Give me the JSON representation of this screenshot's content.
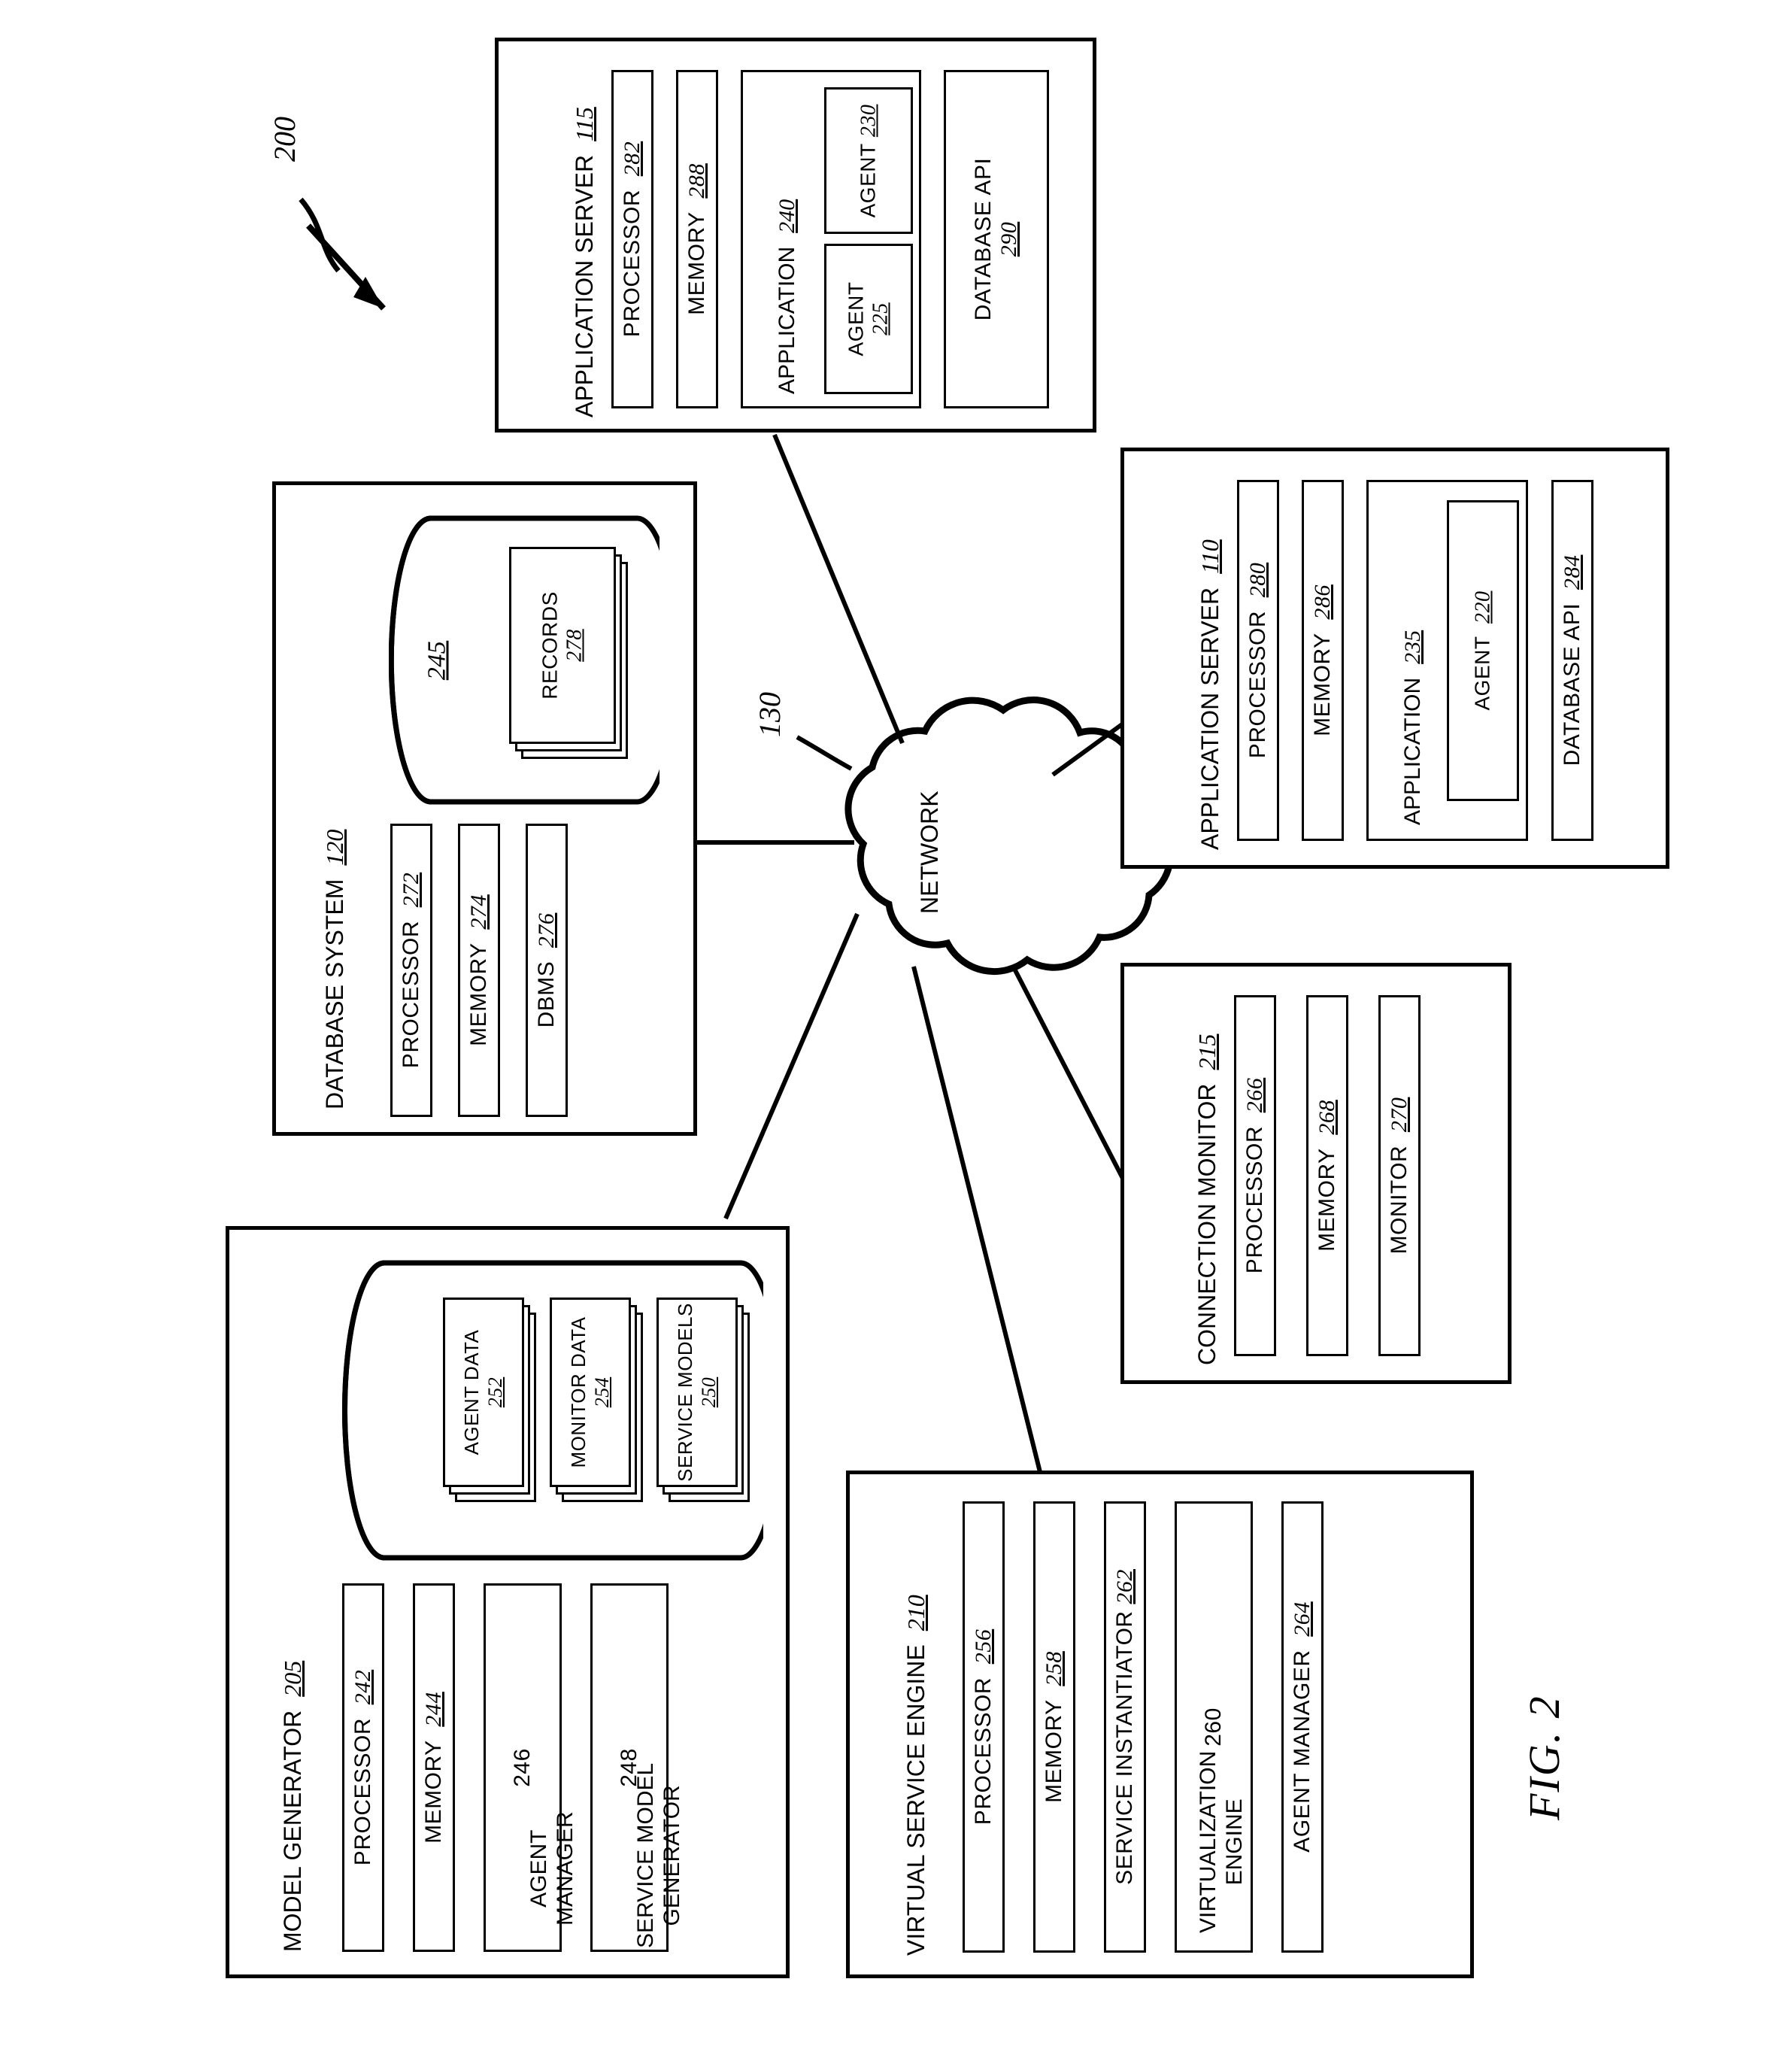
{
  "figure": {
    "caption": "FIG. 2",
    "system_ref": "200",
    "network_ref": "130",
    "network_label": "NETWORK"
  },
  "nodes": {
    "app_server_115": {
      "title": "APPLICATION SERVER",
      "ref": "115",
      "children": [
        {
          "label": "PROCESSOR",
          "ref": "282"
        },
        {
          "label": "MEMORY",
          "ref": "288"
        },
        {
          "label": "APPLICATION",
          "ref": "240"
        },
        {
          "label": "DATABASE API",
          "ref": "290"
        }
      ],
      "agents": [
        {
          "label": "AGENT",
          "ref": "225"
        },
        {
          "label": "AGENT",
          "ref": "230"
        }
      ]
    },
    "app_server_110": {
      "title": "APPLICATION SERVER",
      "ref": "110",
      "children": [
        {
          "label": "PROCESSOR",
          "ref": "280"
        },
        {
          "label": "MEMORY",
          "ref": "286"
        },
        {
          "label": "APPLICATION",
          "ref": "235"
        },
        {
          "label": "DATABASE API",
          "ref": "284"
        }
      ],
      "agents": [
        {
          "label": "AGENT",
          "ref": "220"
        }
      ]
    },
    "database_system_120": {
      "title": "DATABASE SYSTEM",
      "ref": "120",
      "store_ref": "245",
      "records": {
        "label": "RECORDS",
        "ref": "278"
      },
      "children": [
        {
          "label": "PROCESSOR",
          "ref": "272"
        },
        {
          "label": "MEMORY",
          "ref": "274"
        },
        {
          "label": "DBMS",
          "ref": "276"
        }
      ]
    },
    "connection_monitor_215": {
      "title": "CONNECTION MONITOR",
      "ref": "215",
      "children": [
        {
          "label": "PROCESSOR",
          "ref": "266"
        },
        {
          "label": "MEMORY",
          "ref": "268"
        },
        {
          "label": "MONITOR",
          "ref": "270"
        }
      ]
    },
    "model_generator_205": {
      "title": "MODEL GENERATOR",
      "ref": "205",
      "children": [
        {
          "label": "PROCESSOR",
          "ref": "242"
        },
        {
          "label": "MEMORY",
          "ref": "244"
        },
        {
          "label": "AGENT\nMANAGER",
          "ref": "246"
        },
        {
          "label": "SERVICE MODEL\nGENERATOR",
          "ref": "248"
        }
      ],
      "store_items": [
        {
          "label": "AGENT\nDATA",
          "ref": "252"
        },
        {
          "label": "MONITOR\nDATA",
          "ref": "254"
        },
        {
          "label": "SERVICE\nMODELS",
          "ref": "250"
        }
      ]
    },
    "virtual_service_engine_210": {
      "title": "VIRTUAL SERVICE ENGINE",
      "ref": "210",
      "children": [
        {
          "label": "PROCESSOR",
          "ref": "256"
        },
        {
          "label": "MEMORY",
          "ref": "258"
        },
        {
          "label": "SERVICE INSTANTIATOR",
          "ref": "262"
        },
        {
          "label": "VIRTUALIZATION\nENGINE",
          "ref": "260"
        },
        {
          "label": "AGENT MANAGER",
          "ref": "264"
        }
      ]
    }
  }
}
